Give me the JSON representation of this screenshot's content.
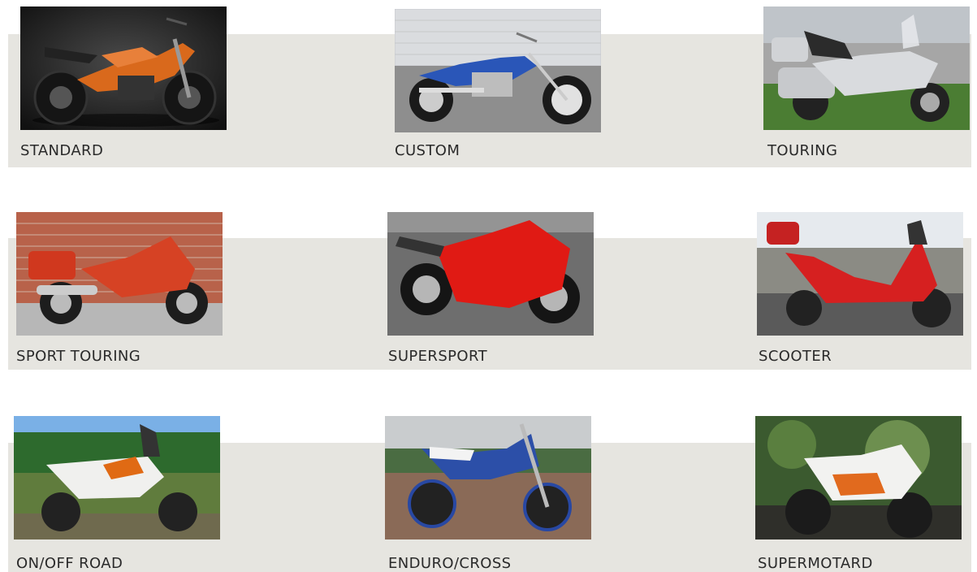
{
  "categories": [
    {
      "label": "STANDARD",
      "subject": "orange-naked-motorcycle",
      "body_color": "#d9691c",
      "scene": "studio-dark"
    },
    {
      "label": "CUSTOM",
      "subject": "blue-cruiser-motorcycle",
      "body_color": "#2a56b8",
      "scene": "street-garage"
    },
    {
      "label": "TOURING",
      "subject": "silver-touring-motorcycle",
      "body_color": "#c7c9cc",
      "scene": "grass-road"
    },
    {
      "label": "SPORT TOURING",
      "subject": "red-sport-touring-motorcycle",
      "body_color": "#d0381e",
      "scene": "brick-wall"
    },
    {
      "label": "SUPERSPORT",
      "subject": "red-supersport-motorcycle",
      "body_color": "#e01a14",
      "scene": "asphalt"
    },
    {
      "label": "SCOOTER",
      "subject": "red-scooter",
      "body_color": "#d62020",
      "scene": "parking-lot"
    },
    {
      "label": "ON/OFF ROAD",
      "subject": "adventure-motorcycle",
      "body_color": "#f0f0ee",
      "scene": "forest-puddle"
    },
    {
      "label": "ENDURO/CROSS",
      "subject": "blue-enduro-motorcycle",
      "body_color": "#2c4fa8",
      "scene": "dirt-field"
    },
    {
      "label": "SUPERMOTARD",
      "subject": "supermotard-motorcycle",
      "body_color": "#f2f2f0",
      "scene": "green-garden"
    }
  ]
}
